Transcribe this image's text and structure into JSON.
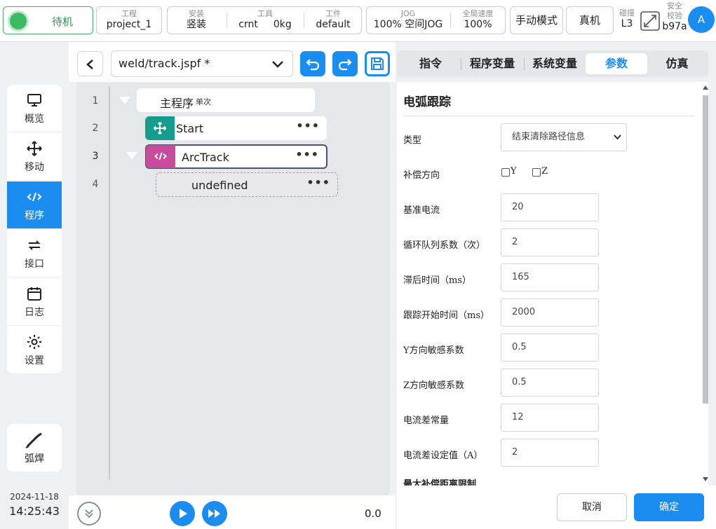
{
  "topbar": {
    "status": "待机",
    "project": {
      "label": "工程",
      "value": "project_1"
    },
    "install": {
      "label": "安装",
      "value": "竖装"
    },
    "tool": {
      "label": "工具",
      "tcp": "crnt",
      "load": "0kg"
    },
    "workpiece": {
      "label": "工件",
      "value": "default"
    },
    "jog": {
      "label": "JOG",
      "value": "100%",
      "mode": "空间JOG"
    },
    "global_speed": {
      "label": "全局速度",
      "value": "100%"
    },
    "manual_mode": "手动模式",
    "real_machine": "真机",
    "collision": {
      "label": "碰撞",
      "value": "L3"
    },
    "safety": {
      "label1": "安全",
      "label2": "校验",
      "value": "b97a"
    },
    "avatar": "A"
  },
  "nav": {
    "items": [
      {
        "label": "概览",
        "icon": "monitor-icon"
      },
      {
        "label": "移动",
        "icon": "move-icon"
      },
      {
        "label": "程序",
        "icon": "code-icon",
        "active": true
      },
      {
        "label": "接口",
        "icon": "swap-icon"
      },
      {
        "label": "日志",
        "icon": "calendar-icon"
      },
      {
        "label": "设置",
        "icon": "gear-icon"
      }
    ],
    "weld": "弧焊",
    "date": "2024-11-18",
    "time": "14:25:43"
  },
  "program": {
    "file": "weld/track.jspf *",
    "nodes": [
      {
        "line": "1",
        "name": "主程序",
        "tag": "单次"
      },
      {
        "line": "2",
        "name": "Start",
        "icon": "move-icon"
      },
      {
        "line": "3",
        "name": "ArcTrack",
        "icon": "code-icon"
      },
      {
        "line": "4",
        "name": "undefined"
      }
    ],
    "speed": "0.0"
  },
  "tabs": [
    "指令",
    "程序变量",
    "系统变量",
    "参数",
    "仿真"
  ],
  "active_tab": "参数",
  "params": {
    "title": "电弧跟踪",
    "type_label": "类型",
    "type_value": "结束清除路径信息",
    "dir_label": "补偿方向",
    "dir_y": "Y",
    "dir_z": "Z",
    "fields": [
      {
        "label": "基准电流",
        "value": "20"
      },
      {
        "label": "循环队列系数（次）",
        "value": "2"
      },
      {
        "label": "滞后时间（ms）",
        "value": "165"
      },
      {
        "label": "跟踪开始时间（ms）",
        "value": "2000"
      },
      {
        "label": "Y方向敏感系数",
        "value": "0.5"
      },
      {
        "label": "Z方向敏感系数",
        "value": "0.5"
      },
      {
        "label": "电流差常量",
        "value": "12"
      },
      {
        "label": "电流差设定值（A）",
        "value": "2"
      }
    ],
    "cut_label": "最大补偿距离限制"
  },
  "footer": {
    "cancel": "取消",
    "ok": "确定"
  },
  "colors": {
    "accent": "#1b8cf0",
    "status_green": "#3dbb62",
    "start_teal": "#169c8c",
    "arctrack_magenta": "#c84b9e"
  }
}
